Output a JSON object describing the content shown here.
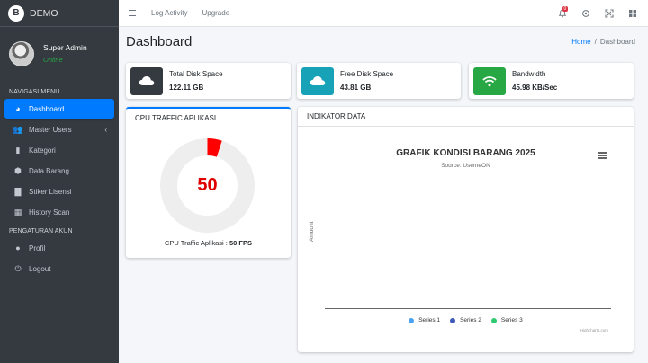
{
  "brand": {
    "logo_letter": "B",
    "name": "DEMO"
  },
  "user": {
    "name": "Super Admin",
    "status": "Online"
  },
  "sidebar": {
    "header_main": "NAVIGASI MENU",
    "items": [
      {
        "label": "Dashboard",
        "icon": "palette-icon",
        "glyph": "◕",
        "active": true
      },
      {
        "label": "Master Users",
        "icon": "users-icon",
        "glyph": "👥",
        "caret": "‹"
      },
      {
        "label": "Kategori",
        "icon": "bookmark-icon",
        "glyph": "▮"
      },
      {
        "label": "Data Barang",
        "icon": "cube-icon",
        "glyph": "⬢"
      },
      {
        "label": "Stiker Lisensi",
        "icon": "sticky-note-icon",
        "glyph": "▇"
      },
      {
        "label": "History Scan",
        "icon": "qrcode-icon",
        "glyph": "▦"
      }
    ],
    "header_account": "PENGATURAN AKUN",
    "account_items": [
      {
        "label": "Profil",
        "icon": "user-circle-icon",
        "glyph": "●"
      },
      {
        "label": "Logout",
        "icon": "power-icon",
        "glyph": "⏻"
      }
    ]
  },
  "topbar": {
    "links": [
      "Log Activity",
      "Upgrade"
    ],
    "notification_count": "0"
  },
  "page": {
    "title": "Dashboard",
    "breadcrumb_home": "Home",
    "breadcrumb_sep": "/",
    "breadcrumb_current": "Dashboard"
  },
  "info_boxes": [
    {
      "label": "Total Disk Space",
      "value": "122.11 GB",
      "icon": "cloud-icon",
      "color": "#343a40"
    },
    {
      "label": "Free Disk Space",
      "value": "43.81 GB",
      "icon": "cloud-icon",
      "color": "#17a2b8"
    },
    {
      "label": "Bandwidth",
      "value": "45.98 KB/Sec",
      "icon": "wifi-icon",
      "color": "#28a745"
    }
  ],
  "cpu_card": {
    "header": "CPU TRAFFIC APLIKASI",
    "gauge_value": 50,
    "gauge_max": 1000,
    "caption_label": "CPU Traffic Aplikasi :",
    "caption_value": "50 FPS",
    "gauge_color": "#ff0000",
    "track_color": "#eeeeee"
  },
  "indicator_card": {
    "header": "INDIKATOR DATA"
  },
  "chart_data": {
    "type": "line",
    "title": "GRAFIK KONDISI BARANG 2025",
    "subtitle": "Source: UsemeON",
    "xlabel": "",
    "ylabel": "Amount",
    "series": [
      {
        "name": "Series 1",
        "values": [],
        "color": "#4aa3f0"
      },
      {
        "name": "Series 2",
        "values": [],
        "color": "#3d5ab8"
      },
      {
        "name": "Series 3",
        "values": [],
        "color": "#2ecc71"
      }
    ],
    "credits": "Highcharts.com"
  }
}
